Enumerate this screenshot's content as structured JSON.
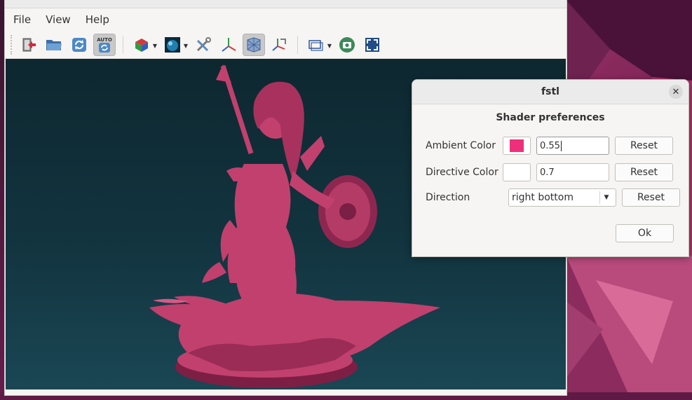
{
  "window": {
    "partial_title": "fstl"
  },
  "menu": [
    "File",
    "View",
    "Help"
  ],
  "toolbar": {
    "auto_label": "AUTO",
    "buttons": [
      "quit-icon",
      "open-folder-icon",
      "reload-icon",
      "autoreload-icon",
      "view-cube-icon",
      "shader-sphere-icon",
      "tools-icon",
      "axes-icon",
      "wireframe-icon",
      "orient-icon",
      "projection-icon",
      "screenshot-icon",
      "fullscreen-icon"
    ]
  },
  "model": {
    "fill_color": "#c2406e"
  },
  "dialog": {
    "title": "fstl",
    "close_symbol": "✕",
    "heading": "Shader preferences",
    "rows": [
      {
        "label": "Ambient Color",
        "color": "#f02f7a",
        "value": "0.55",
        "reset": "Reset"
      },
      {
        "label": "Directive Color",
        "color": "#ffffff",
        "value": "0.7",
        "reset": "Reset"
      },
      {
        "label": "Direction",
        "value": "right bottom",
        "reset": "Reset"
      }
    ],
    "ok": "Ok"
  }
}
